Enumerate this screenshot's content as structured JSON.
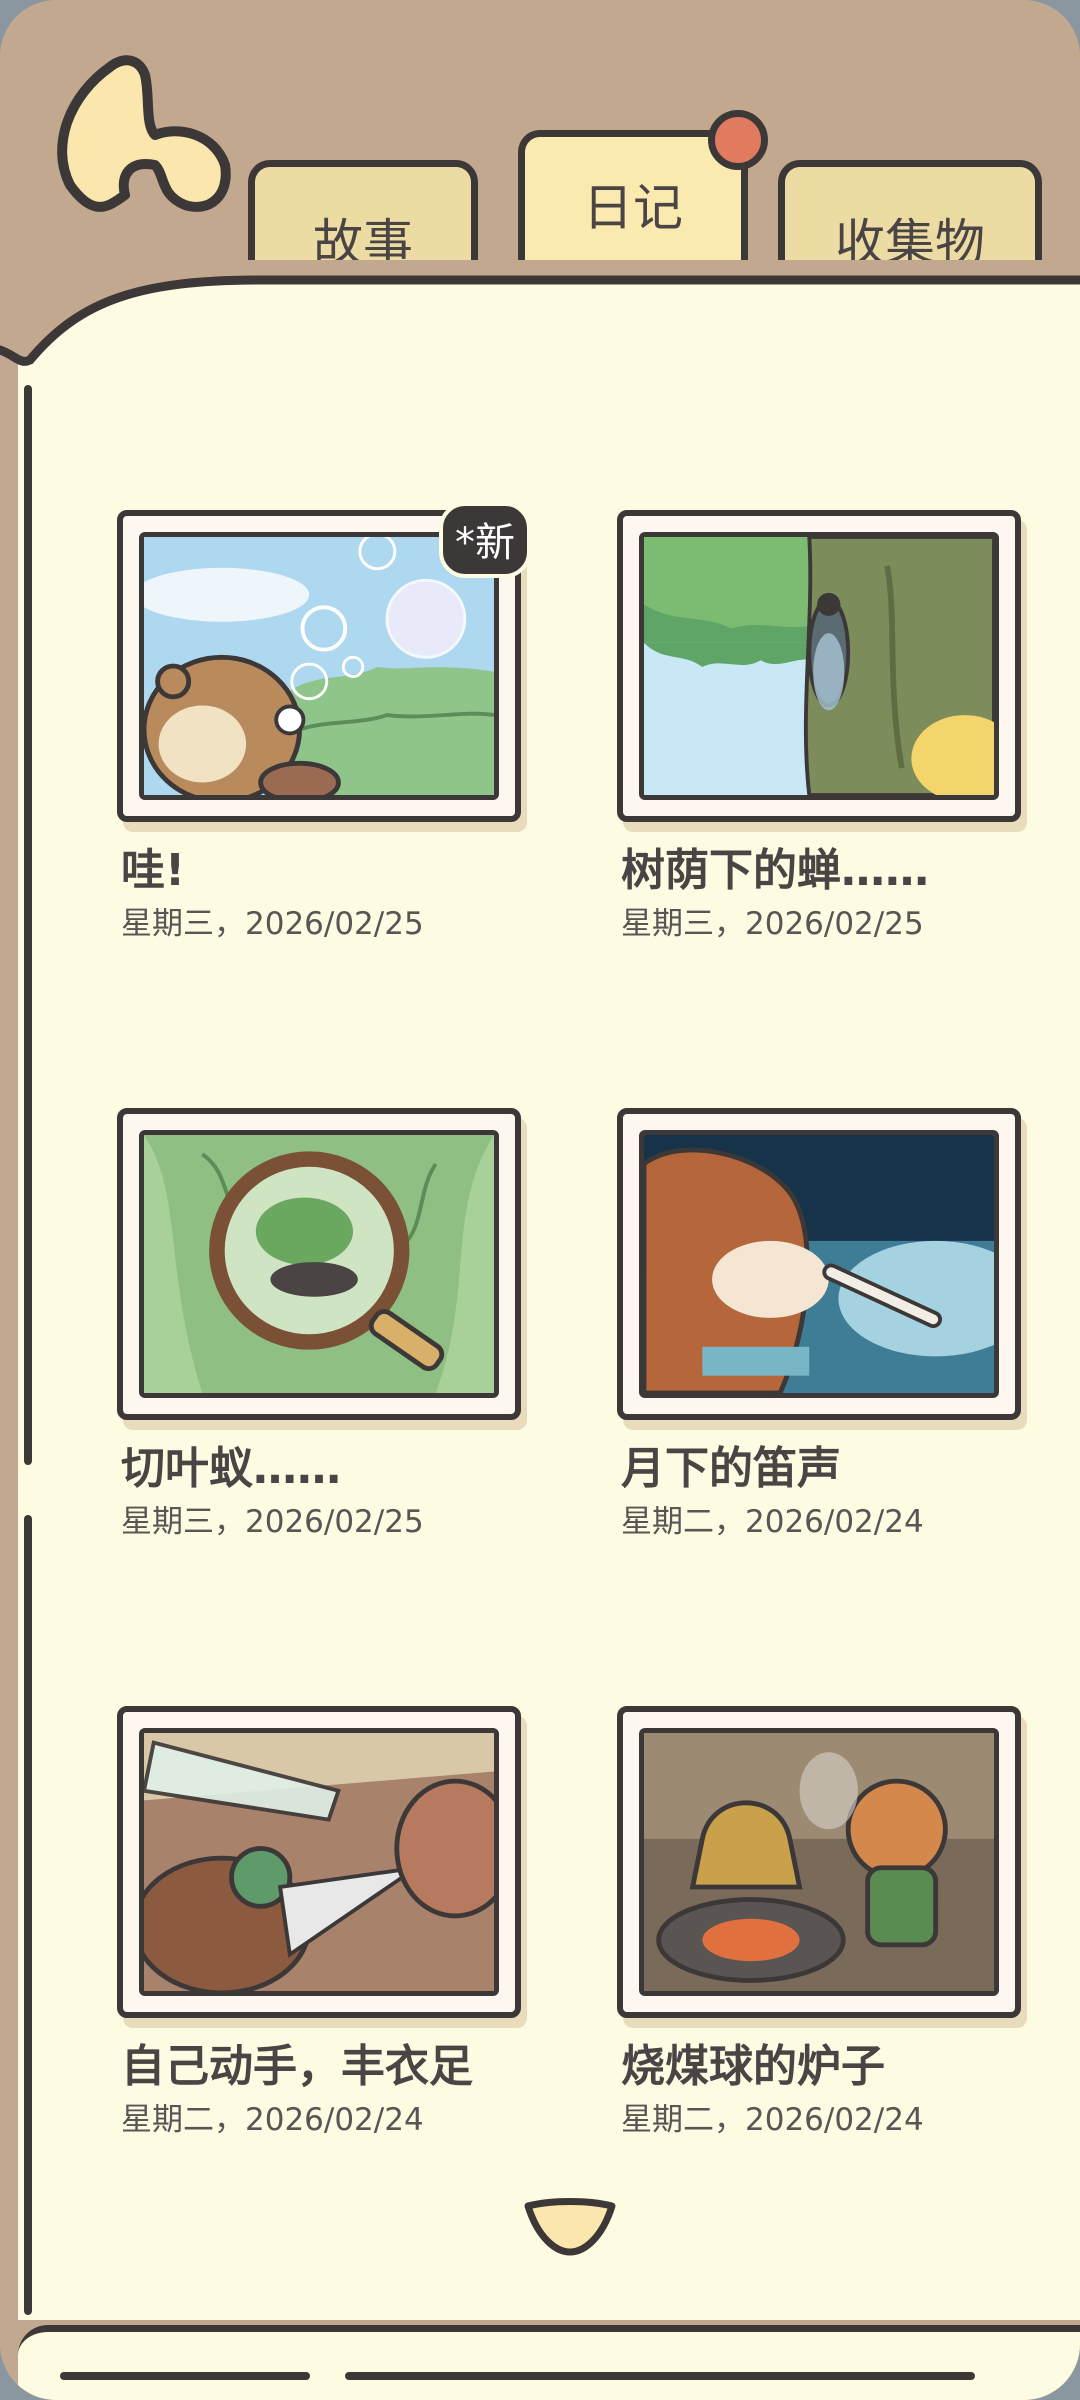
{
  "tabs": {
    "story": "故事",
    "diary": "日记",
    "collection": "收集物"
  },
  "entries": [
    {
      "title": "哇!",
      "date": "星期三，2026/02/25",
      "badge": "*新"
    },
    {
      "title": "树荫下的蝉……",
      "date": "星期三，2026/02/25"
    },
    {
      "title": "切叶蚁……",
      "date": "星期三，2026/02/25"
    },
    {
      "title": "月下的笛声",
      "date": "星期二，2026/02/24"
    },
    {
      "title": "自己动手，丰衣足",
      "date": "星期二，2026/02/24"
    },
    {
      "title": "烧煤球的炉子",
      "date": "星期二，2026/02/24"
    }
  ],
  "icons": {
    "back": "back-arrow-icon",
    "notification": "notification-dot",
    "scroll": "chevron-down-icon"
  },
  "colors": {
    "frame": "#c2a88f",
    "page": "#fefbe3",
    "tab": "#ecdca3",
    "active_tab": "#fbeab0",
    "notification": "#e07b5f",
    "ink": "#3d3838"
  }
}
